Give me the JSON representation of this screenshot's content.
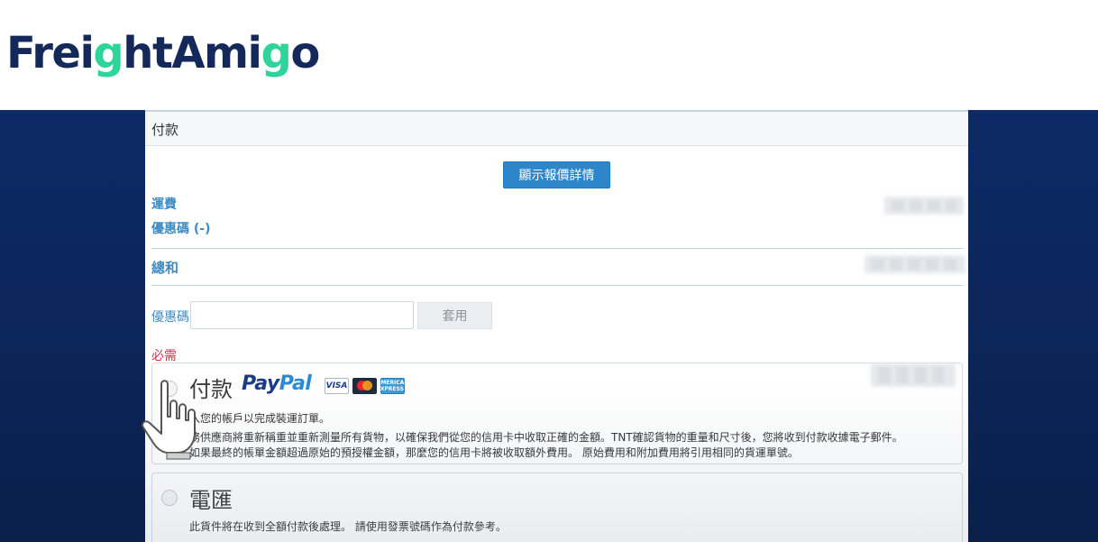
{
  "logo": {
    "part1": "Frei",
    "part2": "g",
    "part3": "htAmi",
    "part4": "g",
    "part5": "o",
    "navy_color": "#15285a",
    "green_color": "#2fd49a"
  },
  "panel": {
    "title": "付款",
    "show_quote_button": "顯示報價詳情",
    "freight_label": "運費",
    "coupon_line_label": "優惠碼 (-)",
    "total_label": "總和",
    "coupon_field_label": "優惠碼",
    "coupon_input_value": "",
    "coupon_input_placeholder": "",
    "apply_button": "套用",
    "required_label": "必需"
  },
  "payment_options": [
    {
      "title": "付款",
      "brand_part1": "Pay",
      "brand_part2": "Pal",
      "cards": [
        "VISA",
        "AMERICAN EXPRESS"
      ],
      "lines": [
        "入您的帳戶以完成裝運訂單。",
        "務供應商將重新稱重並重新測量所有貨物，以確保我們從您的信用卡中收取正確的金額。TNT確認貨物的重量和尺寸後，您將收到付款收據電子郵件。",
        "如果最終的帳單金額超過原始的預授權金額，那麼您的信用卡將被收取額外費用。 原始費用和附加費用將引用相同的貨運單號。"
      ]
    },
    {
      "title": "電匯",
      "lines": [
        "此貨件將在收到全額付款後處理。 請使用發票號碼作為付款參考。"
      ]
    }
  ],
  "colors": {
    "band": "#0d2a66",
    "accent_blue": "#2c86c9",
    "label_blue": "#3e8bc4",
    "required_red": "#c13a4e"
  },
  "icons": [
    "hand-pointer-icon",
    "radio-icon",
    "mastercard-icon"
  ]
}
